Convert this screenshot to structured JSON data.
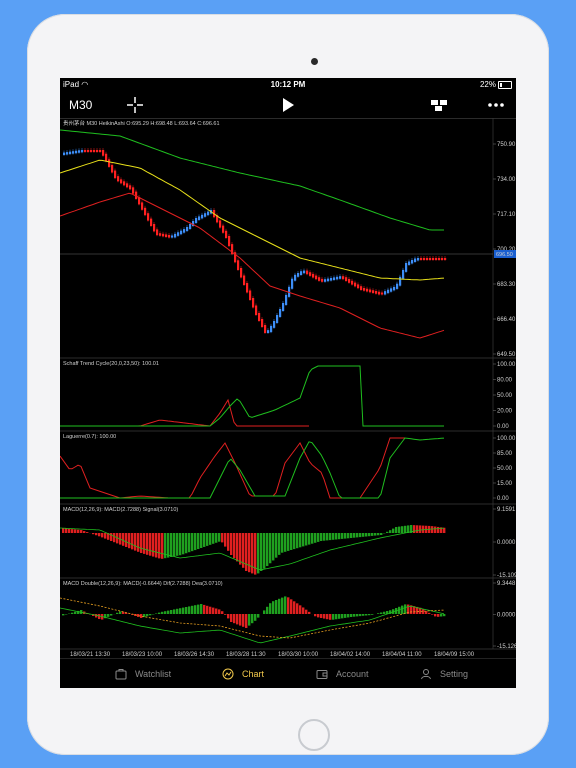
{
  "status": {
    "device": "iPad",
    "time": "10:12 PM",
    "battery": "22%"
  },
  "toolbar": {
    "timeframe": "M30"
  },
  "main": {
    "title": "贵州茅台 M30 HeikinAshi  O:695.29 H:698.48 L:693.64 C:696.61",
    "ticks": [
      "750.90",
      "734.00",
      "717.10",
      "700.20",
      "683.30",
      "666.40",
      "649.50"
    ],
    "price_label": "696.50"
  },
  "stc": {
    "title": "Schaff Trend Cycle(20,0,23,50): 100.01",
    "ticks": [
      "100.00",
      "80.00",
      "50.00",
      "20.00",
      "0.00"
    ]
  },
  "laguerre": {
    "title": "Laguerre(0.7): 100.00",
    "ticks": [
      "100.00",
      "85.00",
      "50.00",
      "15.00",
      "0.00"
    ]
  },
  "macd": {
    "title": "MACD(12,26,9): MACD(2.7288) Signal(3.0710)",
    "ticks": [
      "9.1591",
      "0.0000",
      "-15.109"
    ]
  },
  "macd_double": {
    "title": "MACD Double(12,26,9): MACD(-0.6644) Dif(2.7288) Dea(3.0710)",
    "ticks": [
      "9.3448",
      "0.0000",
      "-15.126"
    ]
  },
  "dates": [
    "18/03/21 13:30",
    "18/03/23 10:00",
    "18/03/26 14:30",
    "18/03/28 11:30",
    "18/03/30 10:00",
    "18/04/02 14:00",
    "18/04/04 11:00",
    "18/04/09 15:00"
  ],
  "tabs": [
    {
      "label": "Watchlist"
    },
    {
      "label": "Chart"
    },
    {
      "label": "Account"
    },
    {
      "label": "Setting"
    }
  ],
  "colors": {
    "up": "#3d8ef7",
    "down": "#ff2020",
    "ma_fast": "#e8e01a",
    "ma_band_upper": "#1fbf1f",
    "ma_band_lower": "#e02020",
    "active_tab": "#f2c94c"
  }
}
